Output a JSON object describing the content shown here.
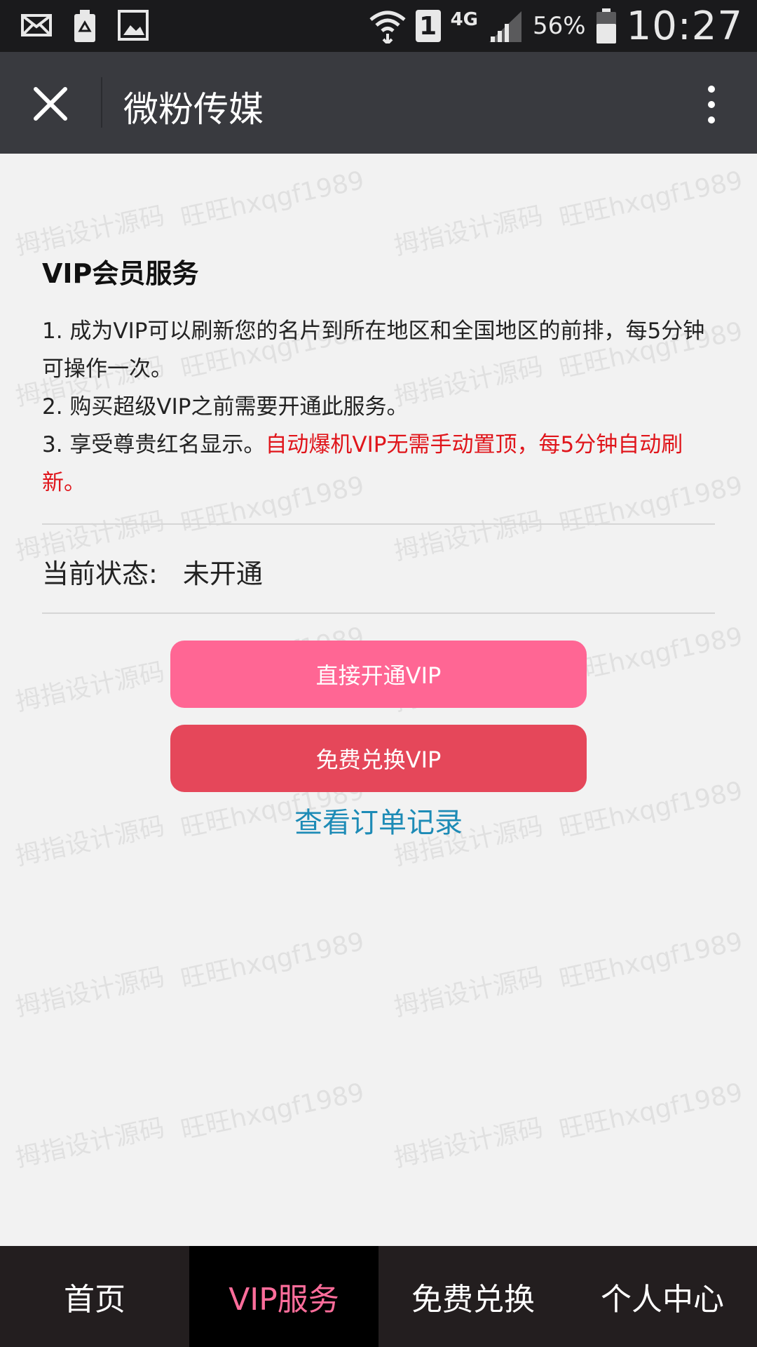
{
  "status_bar": {
    "battery_percent": "56%",
    "time": "10:27",
    "sim_slot": "1",
    "network_type": "4G",
    "icons": [
      "mail-icon",
      "recycle-battery-icon",
      "image-icon",
      "wifi-icon",
      "signal-icon",
      "battery-icon"
    ]
  },
  "header": {
    "title": "微粉传媒",
    "close_icon": "close-icon",
    "more_icon": "more-vertical-icon"
  },
  "vip": {
    "section_title": "VIP会员服务",
    "line1": "1. 成为VIP可以刷新您的名片到所在地区和全国地区的前排，每5分钟可操作一次。",
    "line2": "2. 购买超级VIP之前需要开通此服务。",
    "line3_prefix": "3. 享受尊贵红名显示。",
    "line3_red": "自动爆机VIP无需手动置顶，每5分钟自动刷新。",
    "highlight_color": "#e0151b"
  },
  "status": {
    "label": "当前状态:",
    "value": "未开通"
  },
  "actions": {
    "open_vip_label": "直接开通VIP",
    "open_vip_color": "#ff6694",
    "exchange_vip_label": "免费兑换VIP",
    "exchange_vip_color": "#e5475a",
    "orders_link": "查看订单记录",
    "orders_link_color": "#1d8bb6"
  },
  "watermark": {
    "text_a": "拇指设计源码",
    "text_b": "旺旺hxqgf1989"
  },
  "bottom_nav": {
    "items": [
      {
        "label": "首页",
        "active": false
      },
      {
        "label": "VIP服务",
        "active": true
      },
      {
        "label": "免费兑换",
        "active": false
      },
      {
        "label": "个人中心",
        "active": false
      }
    ],
    "active_color": "#ff6d9b"
  }
}
